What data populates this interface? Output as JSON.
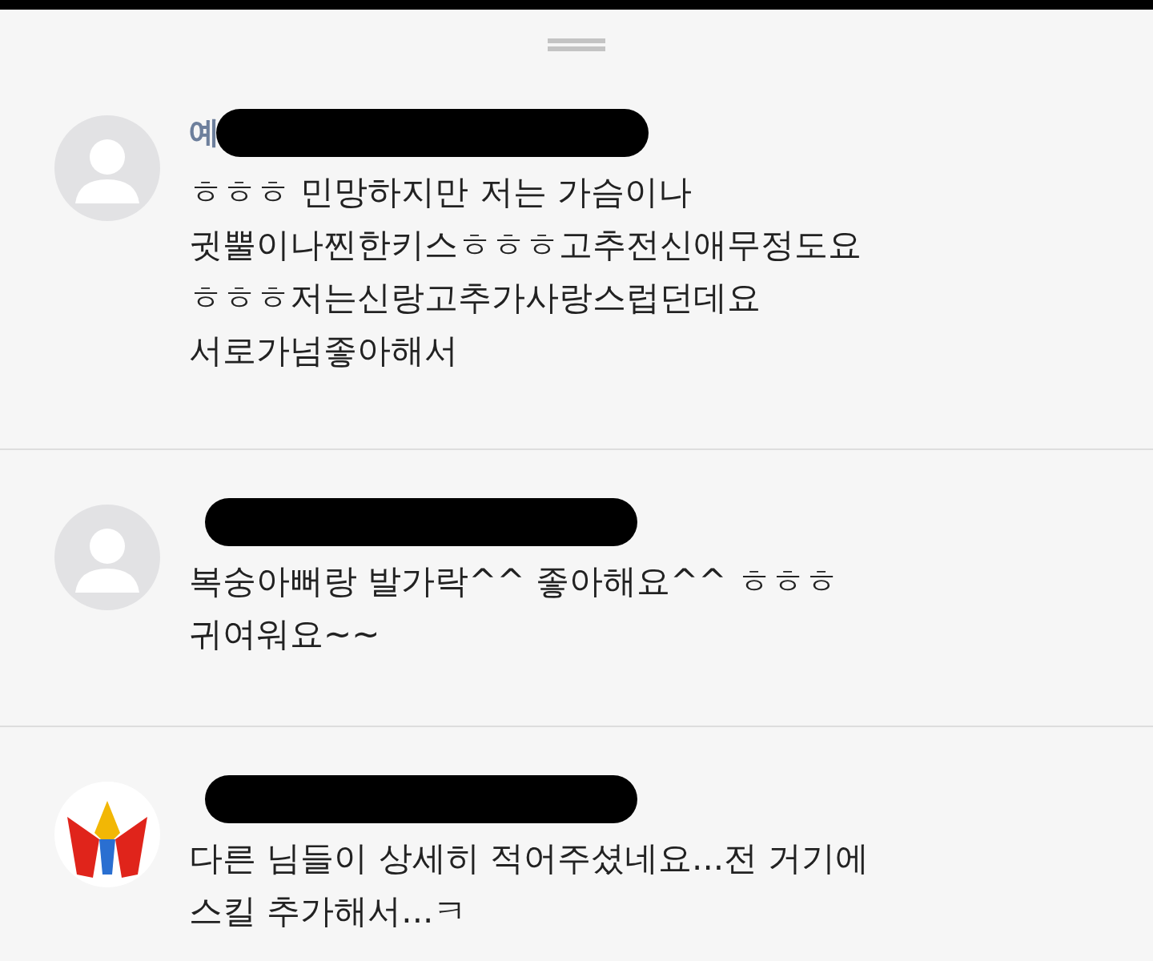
{
  "comments": [
    {
      "avatar": {
        "kind": "default"
      },
      "author": "예",
      "redacted": true,
      "lines": [
        "ㅎㅎㅎ 민망하지만 저는 가슴이나",
        "귓뿔이나찐한키스ㅎㅎㅎ고추전신애무정도요",
        "ㅎㅎㅎ저는신랑고추가사랑스럽던데요",
        "서로가넘좋아해서"
      ]
    },
    {
      "avatar": {
        "kind": "default"
      },
      "redacted": true,
      "lines": [
        "복숭아뻐랑 발가락^^ 좋아해요^^ ㅎㅎㅎ",
        "귀여워요~~"
      ]
    },
    {
      "avatar": {
        "kind": "logo"
      },
      "redacted": true,
      "lines": [
        "다른 님들이 상세히 적어주셨네요...전 거기에",
        "스킬 추가해서...ㅋ"
      ]
    }
  ]
}
